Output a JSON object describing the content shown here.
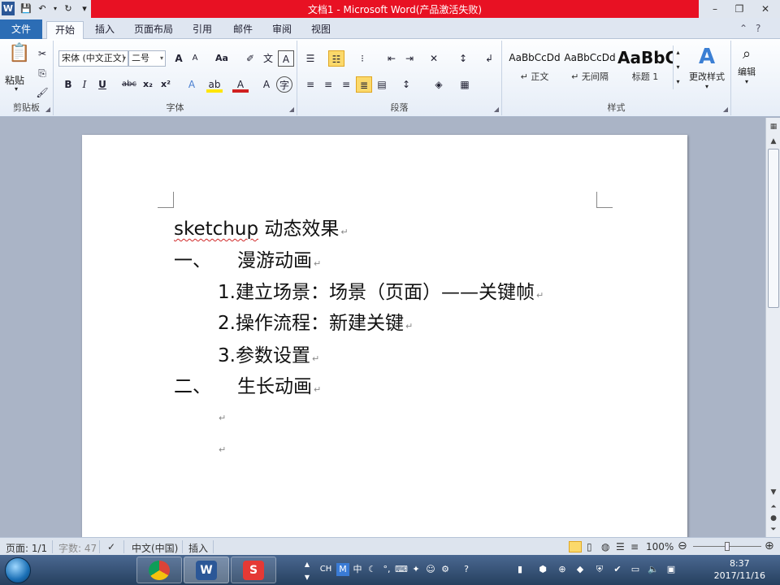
{
  "window": {
    "title": "文档1 - Microsoft Word(产品激活失败)",
    "app_icon": "W"
  },
  "ribbon_tabs": [
    "文件",
    "开始",
    "插入",
    "页面布局",
    "引用",
    "邮件",
    "审阅",
    "视图"
  ],
  "active_tab": "开始",
  "clipboard": {
    "paste_label": "粘贴",
    "group_label": "剪贴板"
  },
  "font": {
    "name": "宋体 (中文正文)",
    "size": "二号",
    "group_label": "字体",
    "bold": "B",
    "italic": "I",
    "underline": "U",
    "strike": "abc",
    "subscript": "x₂",
    "superscript": "x²",
    "grow": "A",
    "shrink": "A",
    "case": "Aa"
  },
  "paragraph": {
    "group_label": "段落"
  },
  "styles": {
    "group_label": "样式",
    "items": [
      {
        "sample": "AaBbCcDd",
        "name": "↵ 正文"
      },
      {
        "sample": "AaBbCcDd",
        "name": "↵ 无间隔"
      },
      {
        "sample": "AaBbC",
        "name": "标题 1"
      }
    ],
    "change_label": "更改样式"
  },
  "editing": {
    "label": "编辑"
  },
  "document": {
    "lines": [
      {
        "text": "sketchup 动态效果"
      },
      {
        "text": "一、",
        "text2": "漫游动画"
      },
      {
        "text": "1.建立场景：场景（页面）——关键帧"
      },
      {
        "text": "2.操作流程：新建关键"
      },
      {
        "text": "3.参数设置"
      },
      {
        "text": "二、",
        "text2": "生长动画"
      }
    ]
  },
  "status": {
    "page": "页面: 1/1",
    "words": "字数: 47",
    "language": "中文(中国)",
    "mode": "插入",
    "zoom": "100%",
    "zoom_level": 0.5
  },
  "taskbar": {
    "ime": "CH",
    "time": "8:37",
    "date": "2017/11/16"
  }
}
